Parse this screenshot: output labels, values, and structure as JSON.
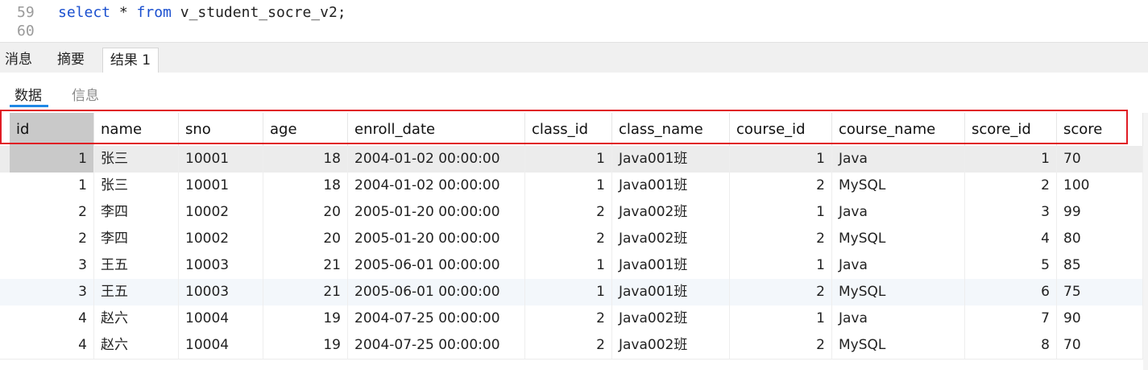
{
  "editor": {
    "lines": [
      {
        "number": "59",
        "keyword1": "select",
        "middle": " * ",
        "keyword2": "from",
        "rest": " v_student_socre_v2;"
      },
      {
        "number": "60",
        "keyword1": "",
        "middle": "",
        "keyword2": "",
        "rest": ""
      }
    ]
  },
  "tabs": [
    {
      "label": "消息"
    },
    {
      "label": "摘要"
    },
    {
      "label": "结果 1"
    }
  ],
  "subtabs": [
    {
      "label": "数据"
    },
    {
      "label": "信息"
    }
  ],
  "table": {
    "columns": [
      "id",
      "name",
      "sno",
      "age",
      "enroll_date",
      "class_id",
      "class_name",
      "course_id",
      "course_name",
      "score_id",
      "score"
    ],
    "rows": [
      [
        "1",
        "张三",
        "10001",
        "18",
        "2004-01-02 00:00:00",
        "1",
        "Java001班",
        "1",
        "Java",
        "1",
        "70"
      ],
      [
        "1",
        "张三",
        "10001",
        "18",
        "2004-01-02 00:00:00",
        "1",
        "Java001班",
        "2",
        "MySQL",
        "2",
        "100"
      ],
      [
        "2",
        "李四",
        "10002",
        "20",
        "2005-01-20 00:00:00",
        "2",
        "Java002班",
        "1",
        "Java",
        "3",
        "99"
      ],
      [
        "2",
        "李四",
        "10002",
        "20",
        "2005-01-20 00:00:00",
        "2",
        "Java002班",
        "2",
        "MySQL",
        "4",
        "80"
      ],
      [
        "3",
        "王五",
        "10003",
        "21",
        "2005-06-01 00:00:00",
        "1",
        "Java001班",
        "1",
        "Java",
        "5",
        "85"
      ],
      [
        "3",
        "王五",
        "10003",
        "21",
        "2005-06-01 00:00:00",
        "1",
        "Java001班",
        "2",
        "MySQL",
        "6",
        "75"
      ],
      [
        "4",
        "赵六",
        "10004",
        "19",
        "2004-07-25 00:00:00",
        "2",
        "Java002班",
        "1",
        "Java",
        "7",
        "90"
      ],
      [
        "4",
        "赵六",
        "10004",
        "19",
        "2004-07-25 00:00:00",
        "2",
        "Java002班",
        "2",
        "MySQL",
        "8",
        "70"
      ]
    ]
  },
  "colors": {
    "keyword": "#1a4fcf",
    "highlight_border": "#e01b24",
    "active_subtab_underline": "#1e88e5"
  }
}
